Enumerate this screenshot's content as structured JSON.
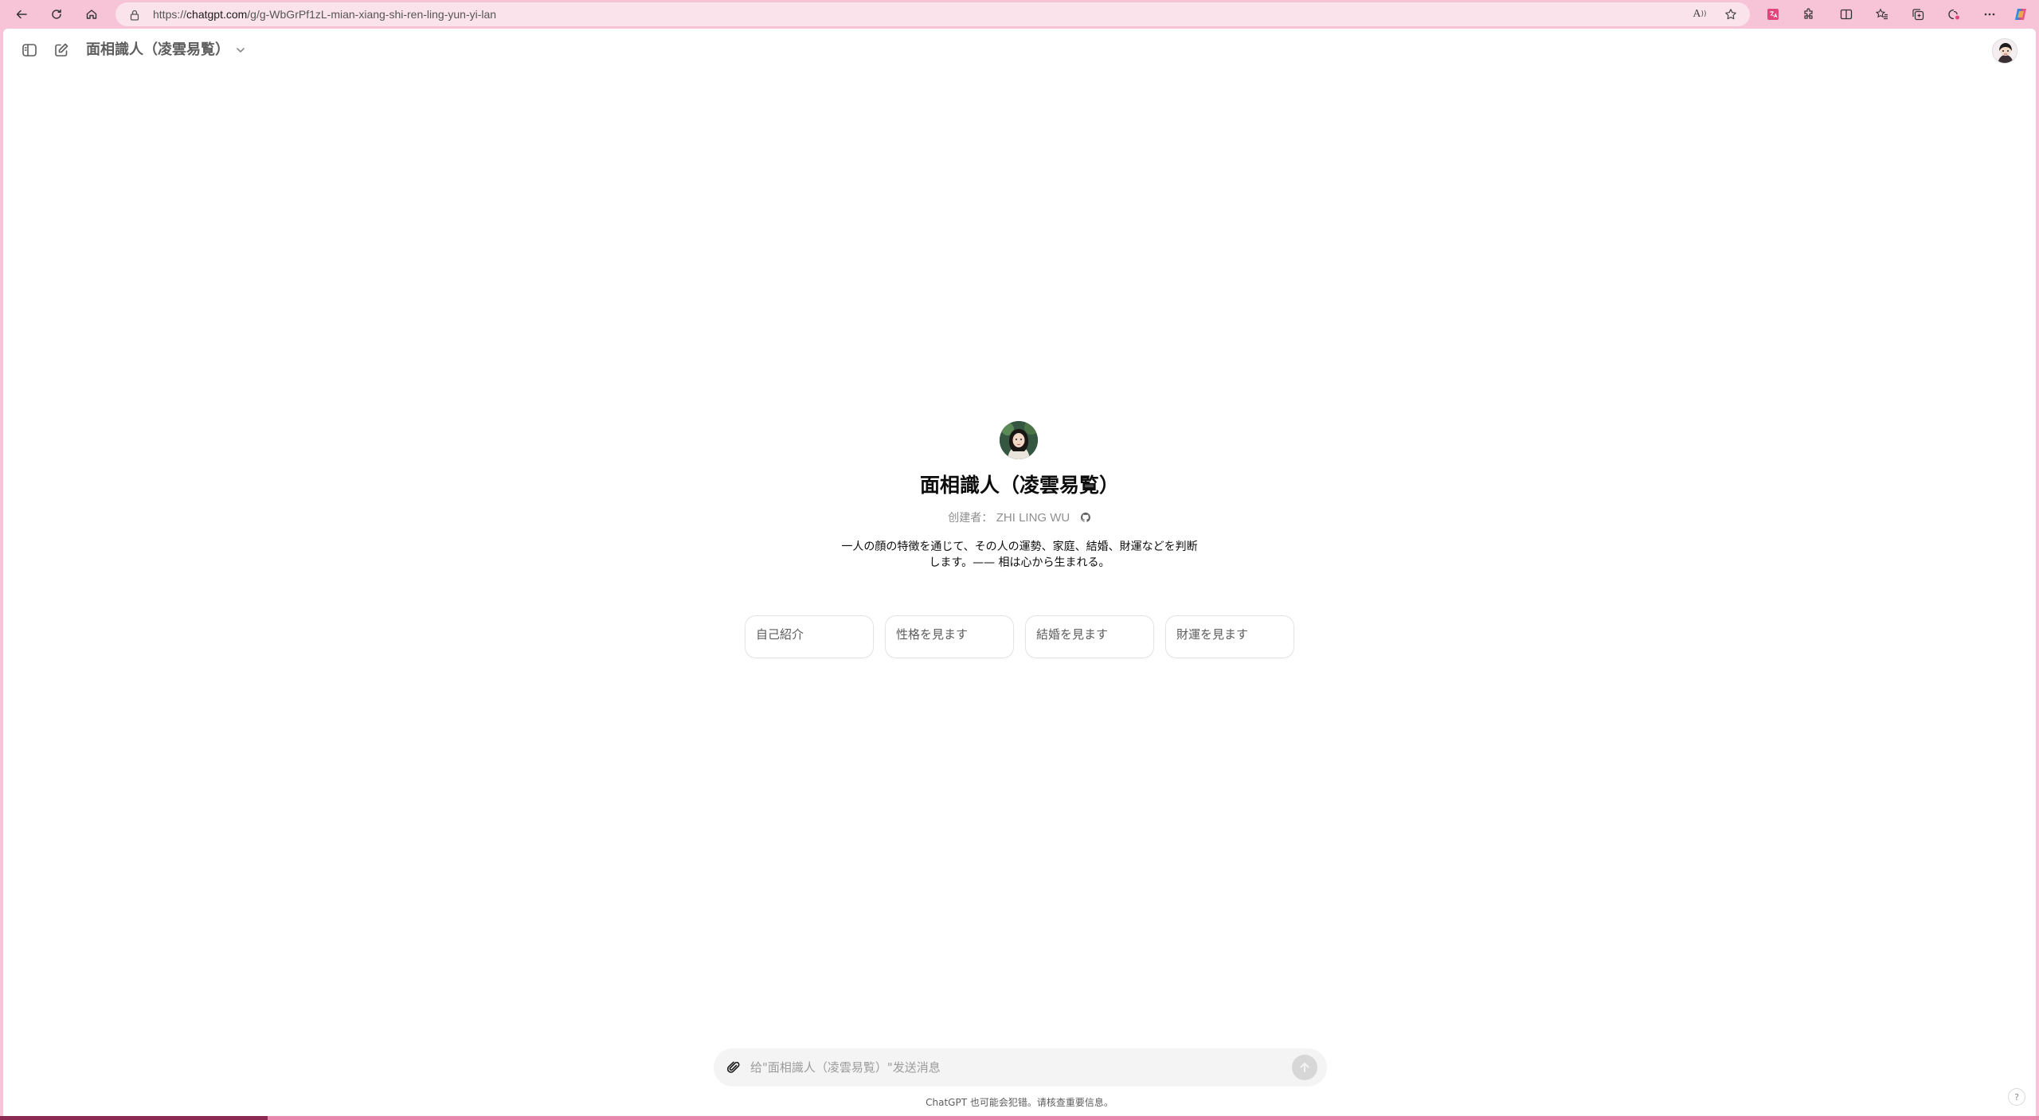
{
  "browser": {
    "url_scheme": "https://",
    "url_host": "chatgpt.com",
    "url_path": "/g/g-WbGrPf1zL-mian-xiang-shi-ren-ling-yun-yi-lan",
    "read_aloud_label": "A",
    "toolbar_icons": [
      "back-icon",
      "refresh-icon",
      "home-icon",
      "lock-icon",
      "read-aloud-icon",
      "favorite-star-icon",
      "translate-icon",
      "extensions-icon",
      "split-screen-icon",
      "favorites-icon",
      "collections-icon",
      "browser-essentials-icon",
      "more-icon",
      "copilot-icon"
    ]
  },
  "header": {
    "title": "面相識人（凌雲易覧）",
    "icons": [
      "sidebar-toggle-icon",
      "new-chat-icon",
      "chevron-down-icon",
      "user-avatar"
    ]
  },
  "gpt": {
    "name": "面相識人（凌雲易覧）",
    "creator_label": "创建者：",
    "creator_name": "ZHI LING WU",
    "description": "一人の顔の特徴を通じて、その人の運勢、家庭、結婚、財運などを判断します。—— 相は心から生まれる。"
  },
  "starters": [
    {
      "label": "自己紹介"
    },
    {
      "label": "性格を見ます"
    },
    {
      "label": "結婚を見ます"
    },
    {
      "label": "財運を見ます"
    }
  ],
  "composer": {
    "placeholder": "给\"面相識人（凌雲易覧）\"发送消息",
    "value": ""
  },
  "footer": {
    "disclaimer": "ChatGPT 也可能会犯错。请核查重要信息。",
    "help": "?"
  },
  "colors": {
    "browser_frame": "#f7c3d6",
    "page_bg": "#ffffff",
    "composer_bg": "#f4f4f4",
    "accent_pink": "#e0457b"
  }
}
